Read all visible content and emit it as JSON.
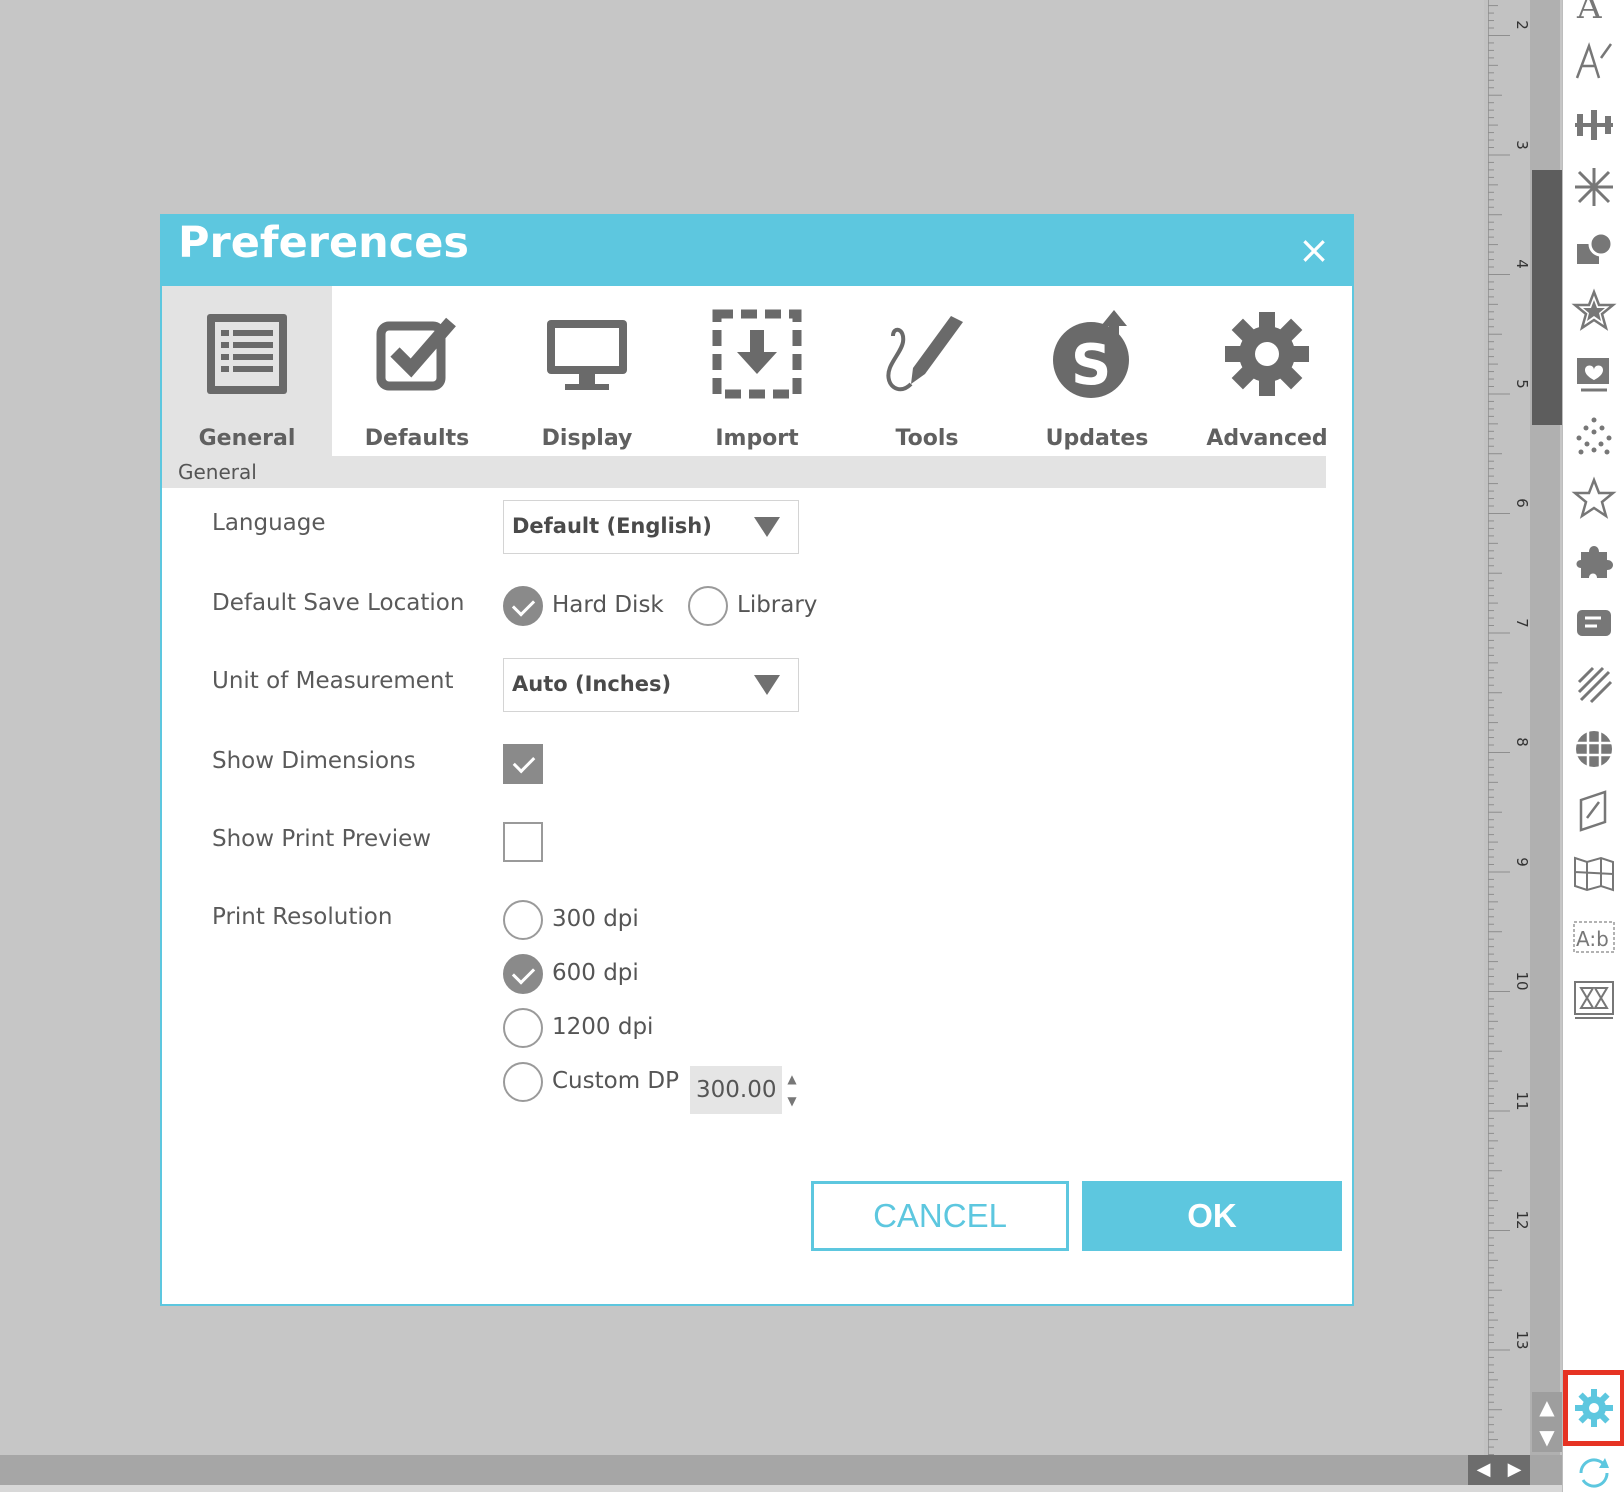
{
  "ruler": {
    "labels": [
      "2",
      "3",
      "4",
      "5",
      "6",
      "7",
      "8",
      "9",
      "10",
      "11",
      "12",
      "13"
    ]
  },
  "dialog": {
    "title": "Preferences",
    "close_glyph": "×",
    "tabs": [
      {
        "label": "General",
        "icon": "list-icon",
        "active": true
      },
      {
        "label": "Defaults",
        "icon": "checkbox-icon",
        "active": false
      },
      {
        "label": "Display",
        "icon": "monitor-icon",
        "active": false
      },
      {
        "label": "Import",
        "icon": "import-icon",
        "active": false
      },
      {
        "label": "Tools",
        "icon": "pencil-icon",
        "active": false
      },
      {
        "label": "Updates",
        "icon": "updates-icon",
        "active": false
      },
      {
        "label": "Advanced",
        "icon": "gear-icon",
        "active": false
      }
    ],
    "section_label": "General",
    "fields": {
      "language": {
        "label": "Language",
        "value": "Default (English)"
      },
      "save_location": {
        "label": "Default Save Location",
        "options": [
          "Hard Disk",
          "Library"
        ],
        "selected": "Hard Disk"
      },
      "unit": {
        "label": "Unit of Measurement",
        "value": "Auto (Inches)"
      },
      "show_dimensions": {
        "label": "Show Dimensions",
        "checked": true
      },
      "show_print_preview": {
        "label": "Show Print Preview",
        "checked": false
      },
      "print_resolution": {
        "label": "Print Resolution",
        "options": [
          "300 dpi",
          "600 dpi",
          "1200 dpi",
          "Custom DP"
        ],
        "selected": "600 dpi",
        "custom_value": "300.00"
      }
    },
    "buttons": {
      "cancel": "CANCEL",
      "ok": "OK"
    }
  },
  "toolbar": {
    "icons": [
      "text-icon",
      "text-style-icon",
      "align-icon",
      "transform-icon",
      "modify-icon",
      "star-icon",
      "library-icon",
      "sparkle-icon",
      "outline-star-icon",
      "puzzle-icon",
      "offset-icon",
      "sketch-icon",
      "grid-icon",
      "page-icon",
      "panel-icon",
      "text-box-icon",
      "pattern-icon",
      "settings-icon",
      "sync-icon"
    ]
  },
  "colors": {
    "accent": "#5dc7df",
    "highlight": "#e63323",
    "canvas": "#c6c6c6"
  }
}
